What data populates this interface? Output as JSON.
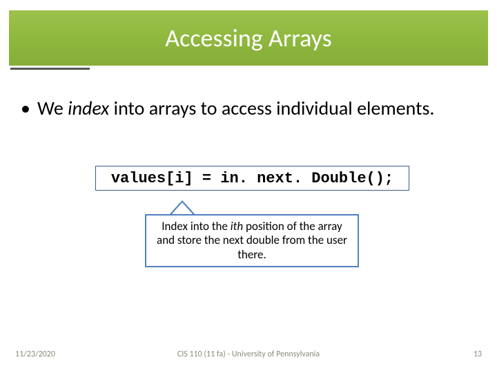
{
  "title": "Accessing Arrays",
  "bullet": {
    "marker": "•",
    "pre": "We ",
    "em": "index",
    "post": " into arrays to access individual elements."
  },
  "code": "values[i] = in. next. Double();",
  "callout": {
    "pre": "Index into the ",
    "em": "ith",
    "post": " position of the array and store the next double from the user there."
  },
  "footer": {
    "date": "11/23/2020",
    "center": "CIS 110 (11 fa) - University of Pennsylvania",
    "page": "13"
  }
}
